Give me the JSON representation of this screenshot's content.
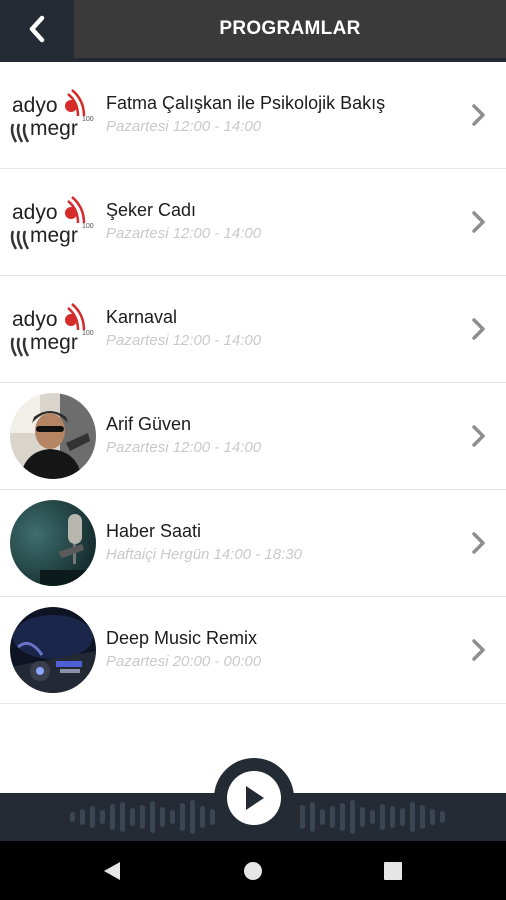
{
  "header": {
    "title": "PROGRAMLAR",
    "back_icon": "chevron-left-icon"
  },
  "programs": [
    {
      "title": "Fatma Çalışkan ile Psikolojik Bakış",
      "time": "Pazartesi 12:00 - 14:00",
      "thumbnail": "radyo-mega-logo"
    },
    {
      "title": "Şeker Cadı",
      "time": "Pazartesi 12:00 - 14:00",
      "thumbnail": "radyo-mega-logo"
    },
    {
      "title": "Karnaval",
      "time": "Pazartesi 12:00 - 14:00",
      "thumbnail": "radyo-mega-logo"
    },
    {
      "title": "Arif Güven",
      "time": "Pazartesi 12:00 - 14:00",
      "thumbnail": "host-photo"
    },
    {
      "title": "Haber Saati",
      "time": "Haftaiçi Hergün 14:00 - 18:30",
      "thumbnail": "studio-microphone-photo"
    },
    {
      "title": "Deep Music Remix",
      "time": "Pazartesi 20:00 - 00:00",
      "thumbnail": "dj-mixer-photo"
    }
  ],
  "logo": {
    "line1": "adyo",
    "line2": "megr",
    "number": "100"
  },
  "player": {
    "play_icon": "play-icon"
  },
  "colors": {
    "header_bg": "#3a3a3a",
    "dark_navy": "#242b35",
    "brand_red": "#d62b2b"
  }
}
